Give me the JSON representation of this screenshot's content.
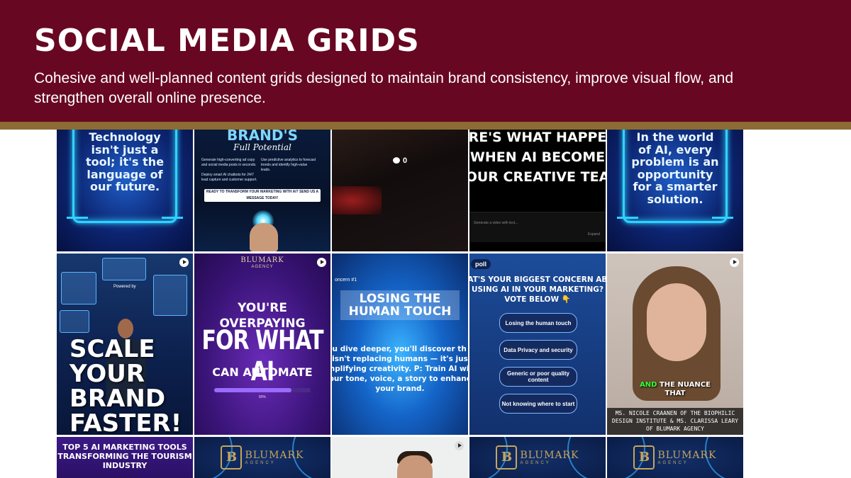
{
  "header": {
    "title": "SOCIAL MEDIA GRIDS",
    "subtitle": "Cohesive and well-planned content grids designed to maintain brand consistency, improve visual flow, and strengthen overall online presence."
  },
  "colors": {
    "banner": "#680722",
    "rule": "#8c6c34"
  },
  "grid": {
    "r1c1": {
      "quote": "Technology isn't just a tool; it's the language of our future."
    },
    "r1c2": {
      "heading": "BRAND'S",
      "script": "Full Potential",
      "bullets": [
        "Generate high-converting ad copy and social media posts in seconds.",
        "Use predictive analytics to forecast trends and identify high-value leads.",
        "Deploy smart AI chatbots for 24/7 lead capture and customer support."
      ],
      "cta": "READY TO TRANSFORM YOUR MARKETING WITH AI? SEND US A MESSAGE TODAY!"
    },
    "r1c3": {
      "comment_count": "0",
      "icon": "comment-bubble-icon"
    },
    "r1c4": {
      "line1": "RE'S WHAT HAPPE",
      "line2": "WHEN AI BECOME",
      "line3": "OUR CREATIVE TEA",
      "hint": "Generate a video with text...",
      "expand": "Expand"
    },
    "r1c5": {
      "quote": "In the world of AI, every problem is an opportunity for a smarter solution."
    },
    "r2c1": {
      "powered": "Powered by",
      "headline": "SCALE YOUR BRAND FASTER!"
    },
    "r2c2": {
      "brand": "BLUMARK",
      "brand_sub": "AGENCY",
      "line1": "YOU'RE OVERPAYING",
      "line2": "FOR WHAT AI",
      "line3": "CAN AUTOMATE",
      "progress_percent": 80,
      "progress_label": "80%"
    },
    "r2c3": {
      "tag": "oncern #1",
      "title": "LOSING THE HUMAN TOUCH",
      "body": "you dive deeper, you'll discover th AI isn't replacing humans — it's jus amplifying creativity. P: Train AI with your tone, voice, a story to enhance your brand."
    },
    "r2c4": {
      "tag": "poll",
      "question": "HAT'S YOUR BIGGEST CONCERN ABO USING AI IN YOUR MARKETING? VOTE BELOW 👇",
      "options": [
        "Losing the human touch",
        "Data Privacy and security",
        "Generic or poor quality content",
        "Not knowing where to start"
      ]
    },
    "r2c5": {
      "caption_green": "AND",
      "caption_white": "THE NUANCE",
      "caption2": "THAT",
      "names": "MS. NICOLE CRAANEN OF THE BIOPHILIC DESIGN INSTITUTE & MS. CLARISSA LEARY OF BLUMARK AGENCY"
    },
    "r3c1": {
      "headline": "TOP 5 AI MARKETING TOOLS TRANSFORMING THE TOURISM INDUSTRY"
    },
    "logo": {
      "mark": "B",
      "name": "BLUMARK",
      "sub": "AGENCY"
    }
  }
}
